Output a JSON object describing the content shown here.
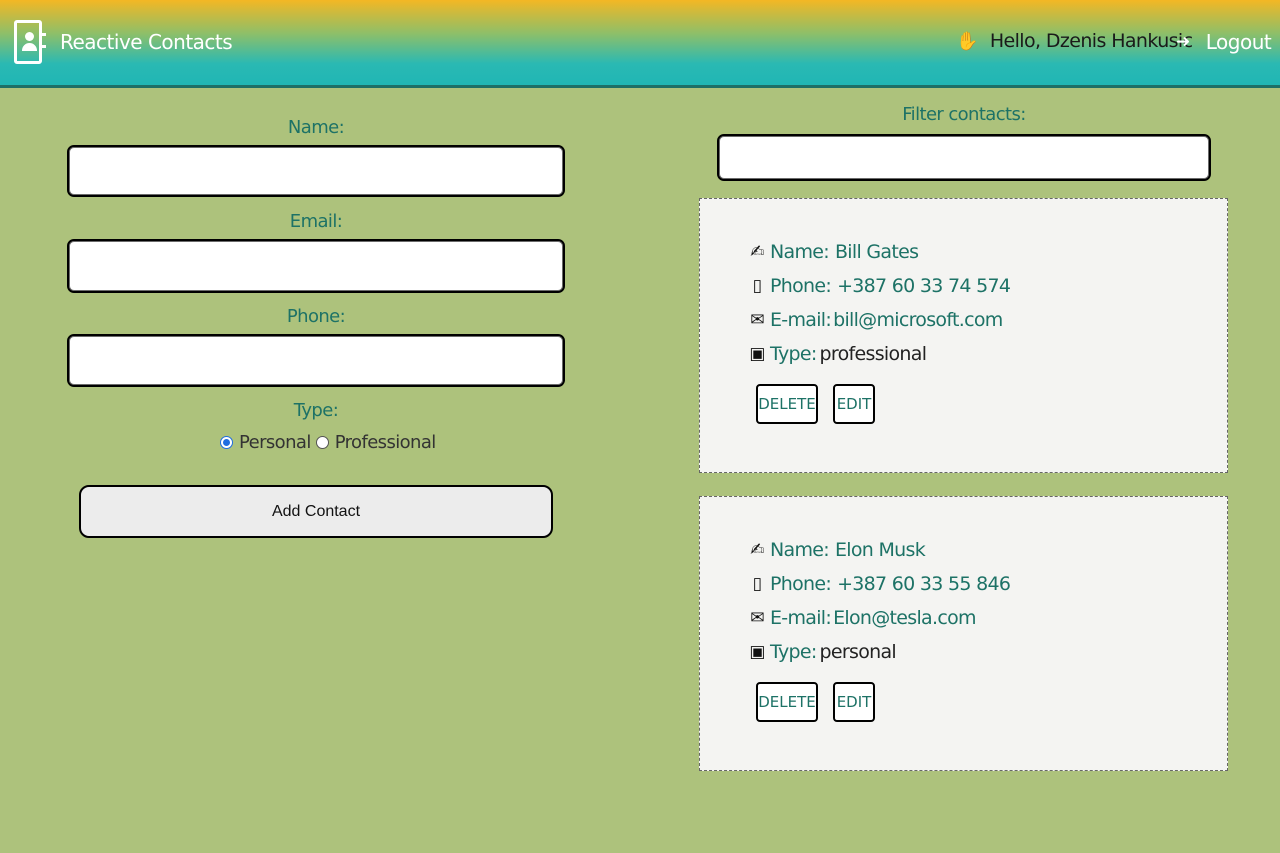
{
  "header": {
    "brand_icon": "address-book-icon",
    "brand_title": "Reactive Contacts",
    "greeting_icon": "waving-hand-icon",
    "greeting": "Hello, Dzenis Hankusic",
    "logout_icon": "sign-out-icon",
    "logout_label": "Logout"
  },
  "form": {
    "name_label": "Name:",
    "name_value": "",
    "email_label": "Email:",
    "email_value": "",
    "phone_label": "Phone:",
    "phone_value": "",
    "type_label": "Type:",
    "type_options": [
      "Personal",
      "Professional"
    ],
    "type_selected": "Personal",
    "submit_label": "Add Contact"
  },
  "filter": {
    "label": "Filter contacts:",
    "value": ""
  },
  "contacts": [
    {
      "name_key": "Name:",
      "name": "Bill Gates",
      "phone_key": "Phone:",
      "phone": "+387 60 33 74 574",
      "email_key": "E-mail:",
      "email": "bill@microsoft.com",
      "type_key": "Type:",
      "type": "professional",
      "delete_label": "DELETE",
      "edit_label": "EDIT"
    },
    {
      "name_key": "Name:",
      "name": "Elon Musk",
      "phone_key": "Phone:",
      "phone": "+387 60 33 55 846",
      "email_key": "E-mail:",
      "email": "Elon@tesla.com",
      "type_key": "Type:",
      "type": "personal",
      "delete_label": "DELETE",
      "edit_label": "EDIT"
    }
  ],
  "colors": {
    "background": "#adc27c",
    "accent_teal": "#1d7266",
    "card_bg": "#f4f4f2",
    "header_top": "#f3b724",
    "header_bottom": "#20b6b4"
  }
}
